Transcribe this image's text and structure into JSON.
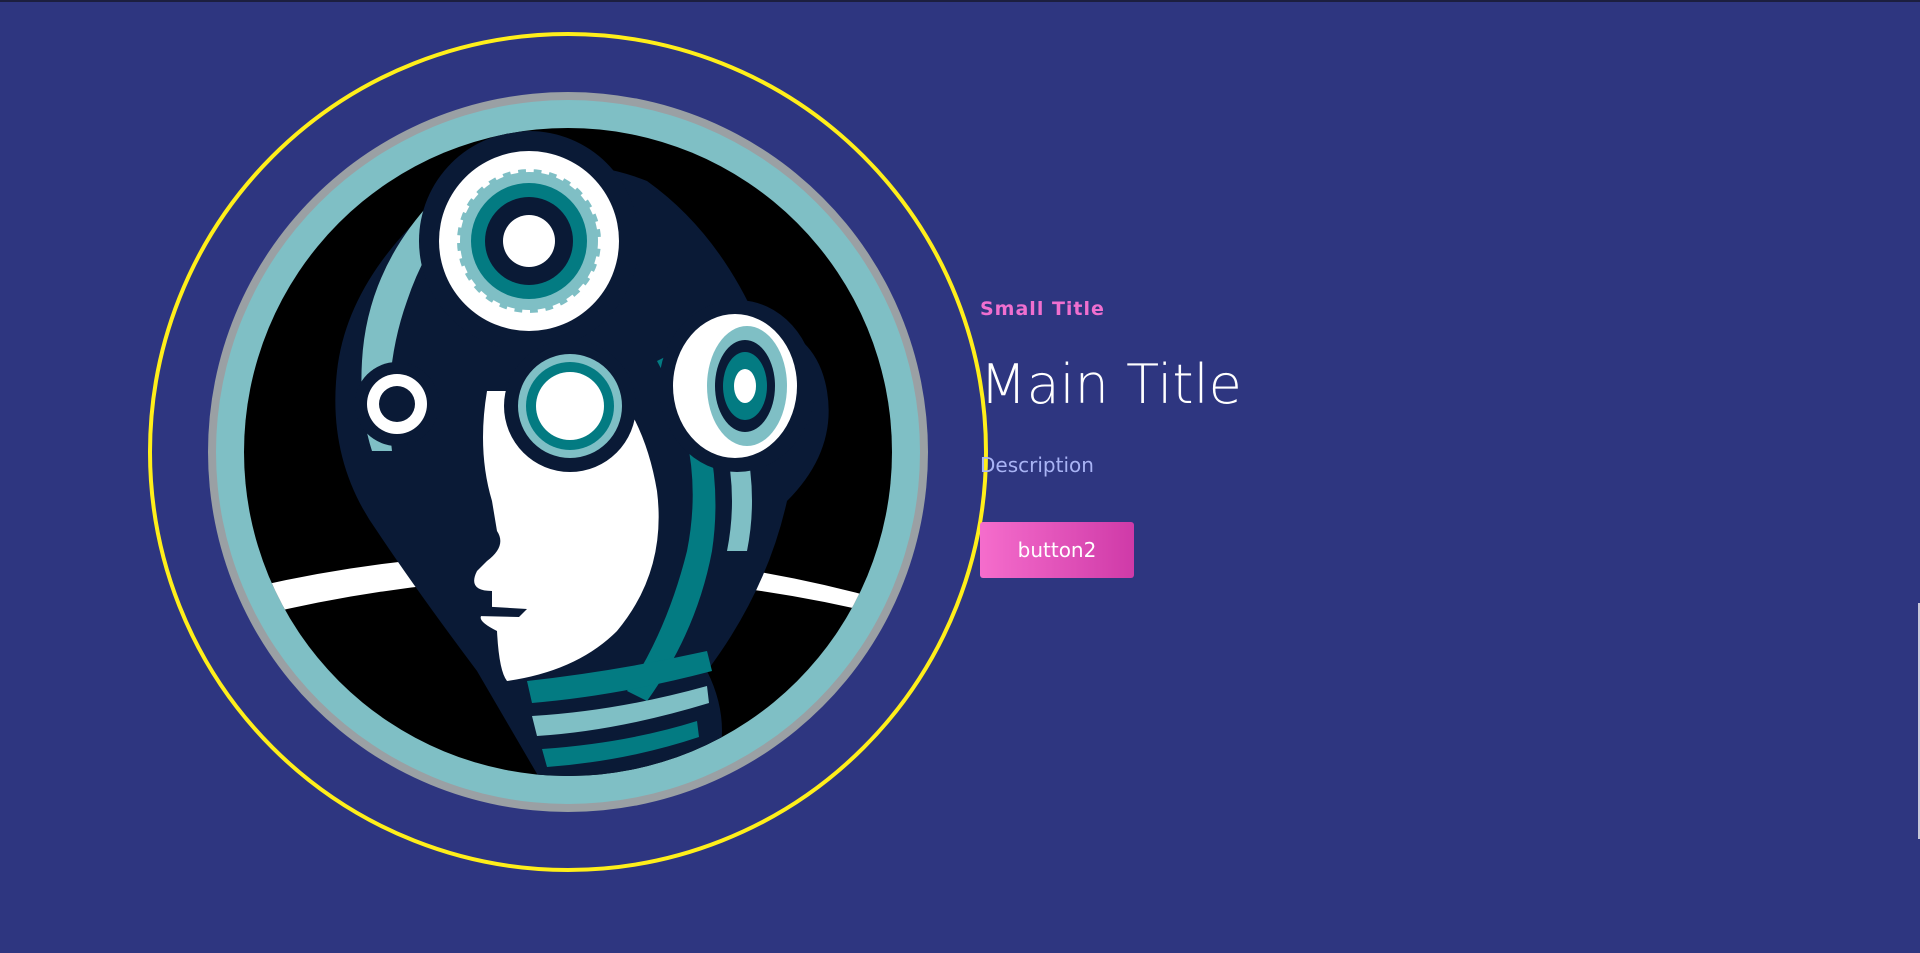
{
  "hero": {
    "small_title": "Small Title",
    "main_title": "Main Title",
    "description": "Description",
    "button_label": "button2"
  },
  "colors": {
    "background": "#2e3680",
    "accent": "#f06fcf",
    "ring": "#ffef1a",
    "teal": "#7fbfc5",
    "dark_teal": "#037b82",
    "navy": "#0a1a36"
  },
  "icons": {
    "logo": "robot-head-gears-logo"
  }
}
